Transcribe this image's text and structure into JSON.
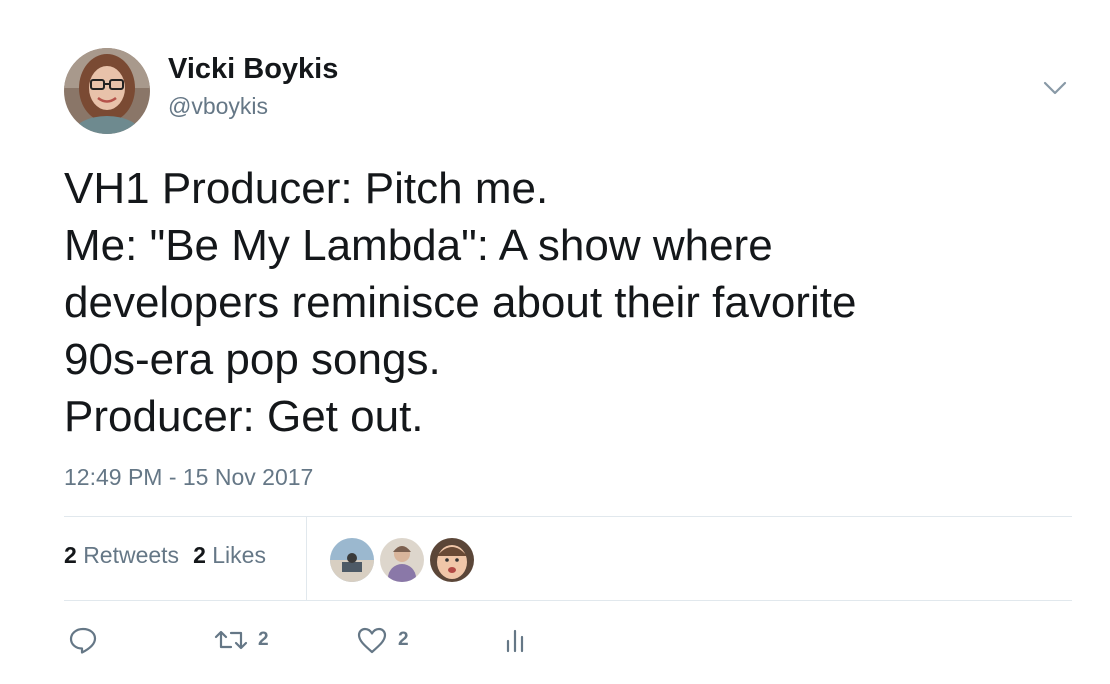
{
  "author": {
    "name": "Vicki Boykis",
    "handle": "@vboykis"
  },
  "tweet": {
    "lines": [
      "VH1 Producer: Pitch me.",
      "Me: \"Be My Lambda\": A show where",
      "developers reminisce about their favorite",
      "90s-era pop songs.",
      "Producer: Get out."
    ],
    "timestamp": "12:49 PM - 15 Nov 2017"
  },
  "stats": {
    "retweets_count": "2",
    "retweets_label": "Retweets",
    "likes_count": "2",
    "likes_label": "Likes"
  },
  "actions": {
    "reply_count": "",
    "retweet_count": "2",
    "like_count": "2"
  },
  "icons": {
    "caret": "chevron-down-icon",
    "reply": "reply-icon",
    "retweet": "retweet-icon",
    "like": "heart-icon",
    "analytics": "analytics-icon"
  },
  "colors": {
    "text": "#14171a",
    "secondary": "#657786",
    "divider": "#e1e8ed"
  }
}
